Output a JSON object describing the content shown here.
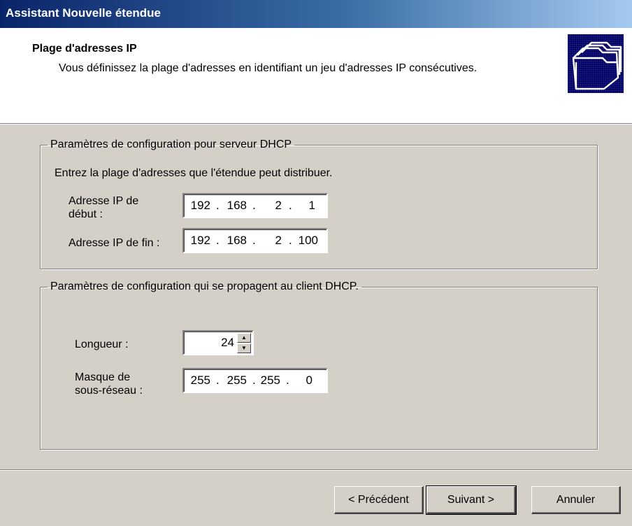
{
  "window": {
    "title": "Assistant Nouvelle étendue"
  },
  "header": {
    "title": "Plage d'adresses IP",
    "description": "Vous définissez la plage d'adresses en identifiant un jeu d'adresses IP consécutives.",
    "icon": "folders-wizard-icon"
  },
  "server_group": {
    "legend": "Paramètres de configuration pour serveur DHCP",
    "instruction": "Entrez la plage d'adresses que l'étendue peut distribuer.",
    "start_ip": {
      "label_line1": "Adresse IP de",
      "label_line2": "début :",
      "octets": [
        "192",
        "168",
        "2",
        "1"
      ]
    },
    "end_ip": {
      "label": "Adresse IP de fin :",
      "octets": [
        "192",
        "168",
        "2",
        "100"
      ]
    }
  },
  "client_group": {
    "legend": "Paramètres de configuration qui se propagent au client DHCP.",
    "length": {
      "label": "Longueur :",
      "value": "24"
    },
    "mask": {
      "label_line1": "Masque de",
      "label_line2": "sous-réseau :",
      "octets": [
        "255",
        "255",
        "255",
        "0"
      ]
    }
  },
  "buttons": {
    "back": "< Précédent",
    "next": "Suivant >",
    "cancel": "Annuler"
  }
}
